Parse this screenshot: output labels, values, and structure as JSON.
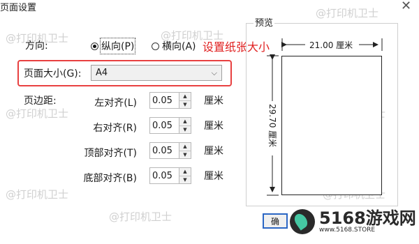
{
  "window": {
    "title": "页面设置",
    "close": "✕"
  },
  "orientation": {
    "label": "方向:",
    "options": [
      {
        "label": "纵向(P)",
        "selected": true
      },
      {
        "label": "横向(A)",
        "selected": false
      }
    ]
  },
  "annotation": "设置纸张大小",
  "page_size": {
    "label": "页面大小(G):",
    "value": "A4"
  },
  "margins": {
    "label": "页边距:",
    "unit": "厘米",
    "rows": [
      {
        "label": "左对齐(L)",
        "value": "0.05"
      },
      {
        "label": "右对齐(R)",
        "value": "0.05"
      },
      {
        "label": "顶部对齐(T)",
        "value": "0.05"
      },
      {
        "label": "底部对齐(B)",
        "value": "0.05"
      }
    ]
  },
  "preview": {
    "title": "预览",
    "width_label": "21.00 厘米",
    "height_label": "29.70 厘米"
  },
  "watermark": "@打印机卫士",
  "ok_button": "确",
  "logo": {
    "name": "5168游戏网",
    "url": "www.5168.STORE"
  },
  "colors": {
    "highlight": "#e84040",
    "annotation": "#e02020",
    "logo_accent": "#45c7a2"
  }
}
